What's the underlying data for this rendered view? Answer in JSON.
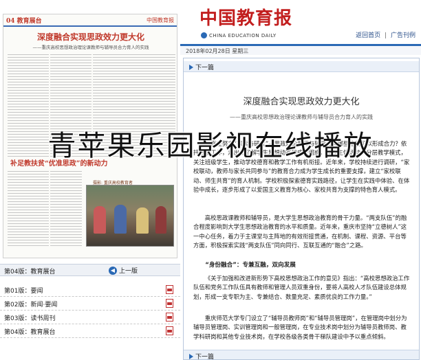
{
  "newspaper": {
    "page_label": "04 教育展台",
    "mini_logo": "中国教育报",
    "title": "深度融合实现思政效力更大化",
    "subtitle": "——重庆高校思想政治理论课教师与辅导员合力育人的实践",
    "sub_headline": "补足教扶贫“优准思政”的新动力",
    "photo_caption": "摄影: 重庆高校教育者"
  },
  "page_nav": {
    "current": "第04版：教育展台",
    "prev_label": "上一版"
  },
  "page_list": [
    {
      "label": "第01版：要闻"
    },
    {
      "label": "第02版：新闻·要闻"
    },
    {
      "label": "第03版：读书周刊"
    },
    {
      "label": "第04版：教育展台"
    }
  ],
  "brand": {
    "name_cn": "中国教育报",
    "name_en": "CHINA EDUCATION DAILY"
  },
  "top_links": {
    "home": "返回首页",
    "ads": "广告刊例",
    "separator": "|"
  },
  "date_text": "2018年02月28日 星期三",
  "article": {
    "next_label": "下一篇",
    "title": "深度融合实现思政效力更大化",
    "subtitle": "——重庆高校思想政治理论课教师与辅导员合力育人的实践",
    "para1": "一直在努力“探索与研究”—思政理论教师与辅导员有哪些途径可以形成合力？依托这项工作，走出去了解学生思想动态和成长困惑，建立主体活动、分层教学模式，关注班级学生，推动学校德育和教学工作有机衔接。近年来，学校持续进行调研，“家校联动，教师与家长共同参与”的教育合力成为学生成长的重要支撑，建立“家校联动、师生共育”的育人机制。学校积极探索德育实践路径，让学生在实践中体验、在体验中成长，逐步形成了以爱国主义教育为核心、家校共育为支撑的特色育人模式。",
    "para2": "高校思政课教师和辅导员，是大学生思想政治教育的骨干力量。“两支队伍”的融合程度影响到大学生思想政治教育的水平和质量。近年来，重庆市坚持“立德树人”这一中心任务，着力于主课堂与主阵地的有效衔接贯通，在机制、课程、资源、平台等方面，积极探索实践“两支队伍”同向同行、互联互通的“融合”之路。",
    "heading2": "“身份融合”：专兼互融，双向发展",
    "para3": "《关于加强和改进新形势下高校思想政治工作的意见》指出：“高校思想政治工作队伍和党务工作队伍具有教师和管理人员双重身份，要将人高校人才队伍建设总体规划，形成一支专职为主、专兼结合、数量充足、素质优良的工作力量。”",
    "para4": "重庆师范大学专门设立了“辅导员教师岗”和“辅导员管理岗”，在管理岗中划分为辅导员管理岗、实训管理岗和一般管理岗，在专业技术岗中划分为辅导员教师岗、教学科研岗和其他专业技术岗，在学校各级各类骨干梯队建设中予以重点倾斜。"
  },
  "overlay_text": "青苹果乐园影视在线播放",
  "colors": {
    "brand_red": "#c21e1e",
    "accent_blue": "#2a69b5",
    "nav_bg": "#eaf0f8"
  }
}
